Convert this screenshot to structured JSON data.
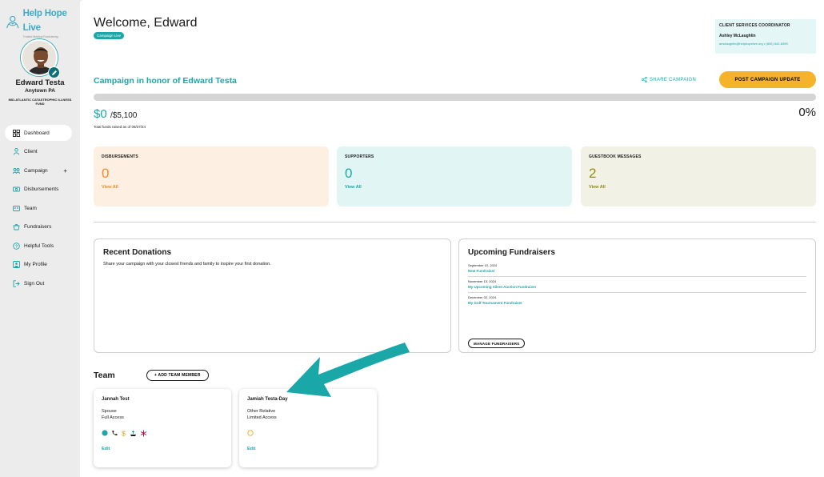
{
  "brand": {
    "name": "Help Hope Live",
    "tagline": "Trusted Medical Fundraising"
  },
  "user": {
    "name": "Edward Testa",
    "location": "Anytown PA",
    "fund": "MID-ATLANTIC CATASTROPHIC ILLNESS FUND"
  },
  "nav": [
    {
      "label": "Dashboard",
      "icon": "dashboard-icon",
      "active": true
    },
    {
      "label": "Client",
      "icon": "person-icon"
    },
    {
      "label": "Campaign",
      "icon": "campaign-icon",
      "expand": "+"
    },
    {
      "label": "Disbursements",
      "icon": "disbursements-icon"
    },
    {
      "label": "Team",
      "icon": "team-icon"
    },
    {
      "label": "Fundraisers",
      "icon": "fundraisers-icon"
    },
    {
      "label": "Helpful Tools",
      "icon": "help-icon"
    },
    {
      "label": "My Profile",
      "icon": "profile-icon"
    },
    {
      "label": "Sign Out",
      "icon": "sign-out-icon"
    }
  ],
  "header": {
    "welcome": "Welcome, Edward",
    "status_badge": "Campaign Live"
  },
  "coordinator": {
    "title": "CLIENT SERVICES COORDINATOR",
    "name": "Ashley McLaughlin",
    "contact": "amclaughlin@helphopelive.org • (800) 642-8399"
  },
  "campaign": {
    "title": "Campaign in honor of Edward Testa",
    "share_label": "SHARE CAMPAIGN",
    "post_update_label": "POST CAMPAIGN UPDATE",
    "raised": "$0",
    "goal": "/$5,100",
    "raised_note": "Total funds raised as of 08/27/24",
    "percent": "0%",
    "progress_fraction": 0
  },
  "stats": [
    {
      "label": "DISBURSEMENTS",
      "value": "0",
      "link": "View All",
      "bg": "#fdefe2",
      "accent": "#f08a2b"
    },
    {
      "label": "SUPPORTERS",
      "value": "0",
      "link": "View All",
      "bg": "#e1f5f4",
      "accent": "#1aa7a8"
    },
    {
      "label": "GUESTBOOK MESSAGES",
      "value": "2",
      "link": "View All",
      "bg": "#f2f1e6",
      "accent": "#8e8b16"
    }
  ],
  "donations": {
    "title": "Recent Donations",
    "text": "Share your campaign with your closest friends and family to inspire your first donation."
  },
  "fundraisers": {
    "title": "Upcoming Fundraisers",
    "items": [
      {
        "date": "September 10, 2024",
        "name": "New Fundraiser"
      },
      {
        "date": "November 13, 2024",
        "name": "My Upcoming Silent Auction Fundraiser"
      },
      {
        "date": "December 02, 2024",
        "name": "My Golf Tournament Fundraiser"
      }
    ],
    "manage_label": "MANAGE FUNDRAISERS"
  },
  "team": {
    "title": "Team",
    "add_label": "+ ADD TEAM MEMBER",
    "members": [
      {
        "name": "Jannah Test",
        "relation": "Spouse",
        "access": "Full Access",
        "edit": "Edit"
      },
      {
        "name": "Jamiah Testa-Day",
        "relation": "Other Relative",
        "access": "Limited Access",
        "edit": "Edit"
      }
    ]
  },
  "colors": {
    "teal": "#1aa7a8",
    "yellow": "#f5b32c",
    "orange": "#f08a2b",
    "olive": "#8e8b16"
  }
}
